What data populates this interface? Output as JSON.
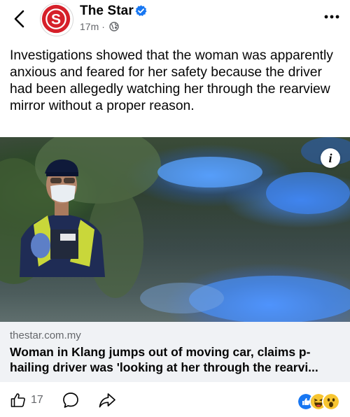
{
  "header": {
    "page_name": "The Star",
    "avatar_letter": "S",
    "timestamp": "17m",
    "separator": "·"
  },
  "post": {
    "text": "Investigations showed that the woman was apparently anxious and feared for her safety because the driver had been allegedly watching her through the rearview mirror without a proper reason."
  },
  "link": {
    "domain": "thestar.com.my",
    "title_line1": "Woman in Klang jumps out of moving car, claims p-",
    "title_line2": "hailing driver was 'looking at her through the rearvi...",
    "info_label": "i"
  },
  "actions": {
    "like_count": "17"
  },
  "icons": {
    "back": "chevron-left-icon",
    "verified": "verified-badge-icon",
    "audience": "globe-icon",
    "more": "more-dots-icon",
    "like": "thumbs-up-icon",
    "comment": "comment-icon",
    "share": "share-icon",
    "reactions": [
      "like-reaction-icon",
      "haha-reaction-icon",
      "wow-reaction-icon"
    ]
  },
  "colors": {
    "brand_red": "#d6202a",
    "verified_blue": "#1877f2",
    "secondary_text": "#65676b",
    "card_background": "#f0f2f5"
  }
}
